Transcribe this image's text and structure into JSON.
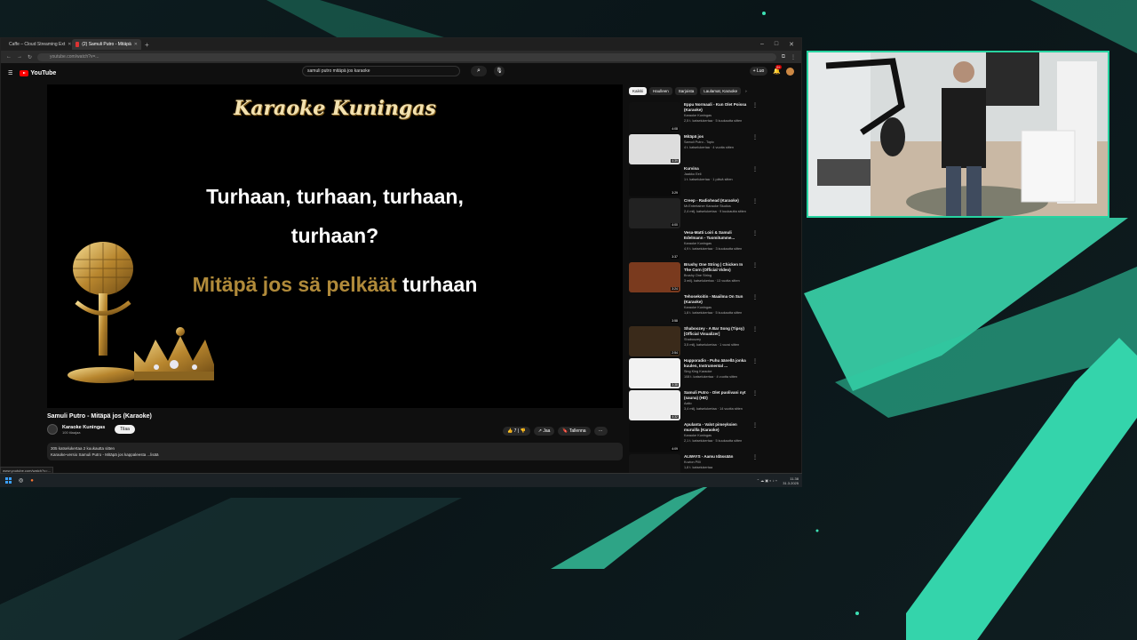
{
  "browser": {
    "tabs": [
      {
        "label": "Caffe – Cloud Streaming Ext",
        "active": false
      },
      {
        "label": "(2) Samuli Putro - Mitäpä",
        "active": true
      }
    ],
    "url": "youtube.com/watch?v=..."
  },
  "youtube": {
    "logo": "YouTube",
    "search_value": "samuli putro mitäpä jos karaoke",
    "create_label": "Luo",
    "notif_count": "9+"
  },
  "video": {
    "brand": "Karaoke Kuningas",
    "lyric_line1": "Turhaan, turhaan, turhaan,",
    "lyric_line2": "turhaan?",
    "lyric_sung": "Mitäpä jos sä pelkäät",
    "lyric_unsung": " turhaan"
  },
  "meta": {
    "title": "Samuli Putro - Mitäpä jos (Karaoke)",
    "channel": "Karaoke Kuningas",
    "subscribers": "100 tilaajaa",
    "subscribe_label": "Tilaa",
    "likes": "7",
    "share_label": "Jaa",
    "save_label": "Tallenna",
    "more_label": "···",
    "desc_line1": "305 katselukertaa  2 kuukautta sitten",
    "desc_line2": "Karaoke-versio Samuli Putro - Mitäpä jos kappaleesta  ...lisää"
  },
  "status_url": "www.youtube.com/watch?v=...",
  "sidebar": {
    "chips": [
      "Kaikki",
      "Haulleen",
      "Sarjoista",
      "Laulamat, Karaoke"
    ],
    "items": [
      {
        "title": "Eppu Normaali - Kun Olet Poissa (Karaoke)",
        "channel": "Karaoke Kuningas",
        "meta": "2,5 t. katselukertaa · 5 kuukautta sitten",
        "duration": "4:08"
      },
      {
        "title": "Mitäpä jos",
        "channel": "Samuli Putro - Topic",
        "meta": "4 t. katselukertaa · 4 vuotta sitten",
        "duration": "4:39"
      },
      {
        "title": "Kurvina",
        "channel": "Jaakko Eeli",
        "meta": "1 t. katselukertaa · 1 päivä sitten",
        "duration": "3:29"
      },
      {
        "title": "Creep - Radiohead (Karaoke)",
        "channel": "Mr.Entertainer Karaoke Studios",
        "meta": "2,4 milj. katselukertaa · 9 kuukautta sitten",
        "duration": "4:00"
      },
      {
        "title": "Vesa-Matti Loiri & Samuli Edelmann - Tuomitumme...",
        "channel": "Karaoke Kuningas",
        "meta": "4,9 t. katselukertaa · 3 kuukautta sitten",
        "duration": "3:37"
      },
      {
        "title": "Brushy One String | Chicken In The Corn (Official Video)",
        "channel": "Brushy One String",
        "meta": "3 milj. katselukertaa · 13 vuotta sitten",
        "duration": "3:24"
      },
      {
        "title": "Tehosekoitin - Maailma On Sun (Karaoke)",
        "channel": "Karaoke Kuningas",
        "meta": "1,8 t. katselukertaa · 5 kuukautta sitten",
        "duration": "3:58"
      },
      {
        "title": "Shaboozey - A Bar Song (Tipsy) [Official Visualizer]",
        "channel": "Shaboozey",
        "meta": "3,5 milj. katselukertaa · 1 vuosi sitten",
        "duration": "2:54"
      },
      {
        "title": "Happoradio - Puhu äänellä jonka kuulen, Instrumental ...",
        "channel": "Sing King Karaoke",
        "meta": "108 t. katselukertaa · 4 vuotta sitten",
        "duration": "3:38"
      },
      {
        "title": "Samuli Putro - Olet puolivani nyt (sauna) (HD)",
        "channel": "Aalto",
        "meta": "3,4 milj. katselukertaa · 14 vuotta sitten",
        "duration": "4:32"
      },
      {
        "title": "Apulanta - Valot pimeyksien muruilla (Karaoke)",
        "channel": "Karaoke Kuningas",
        "meta": "2,1 t. katselukertaa · 5 kuukautta sitten",
        "duration": "4:09"
      },
      {
        "title": "ALWAYS - Aamu Idässään",
        "channel": "Kuvion Pilli",
        "meta": "1,8 t. katselukertaa",
        "duration": ""
      }
    ]
  },
  "taskbar": {
    "time": "11.38",
    "date": "31.3.2025"
  },
  "colors": {
    "accent": "#27d3a0",
    "yt_red": "#ff0000",
    "gold": "#b08a3a"
  }
}
